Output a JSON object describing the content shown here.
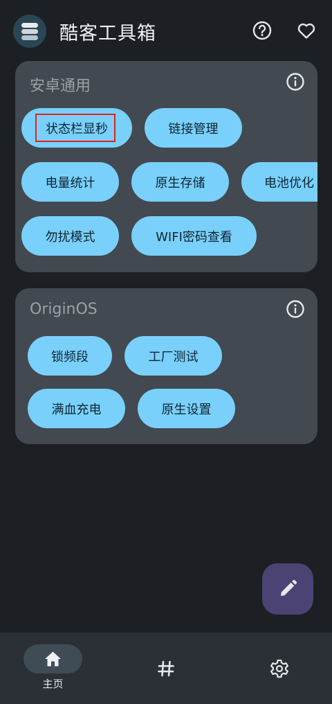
{
  "app": {
    "title": "酷客工具箱"
  },
  "cards": [
    {
      "title": "安卓通用",
      "chips": [
        "状态栏显秒",
        "链接管理",
        "电量统计",
        "原生存储",
        "电池优化",
        "勿扰模式",
        "WIFI密码查看"
      ]
    },
    {
      "title": "OriginOS",
      "chips": [
        "锁频段",
        "工厂测试",
        "满血充电",
        "原生设置"
      ]
    }
  ],
  "bottom_nav": {
    "home_label": "主页"
  },
  "colors": {
    "background": "#1c1f23",
    "card": "#434950",
    "chip": "#79d0fb",
    "fab": "#4a4373",
    "nav": "#2b3036",
    "selection": "#e0201b"
  },
  "icons": {
    "header": [
      "help-icon",
      "heart-icon"
    ],
    "card": "info-icon",
    "fab": "pencil-icon",
    "nav": [
      "home-icon",
      "hash-icon",
      "settings-icon"
    ]
  }
}
